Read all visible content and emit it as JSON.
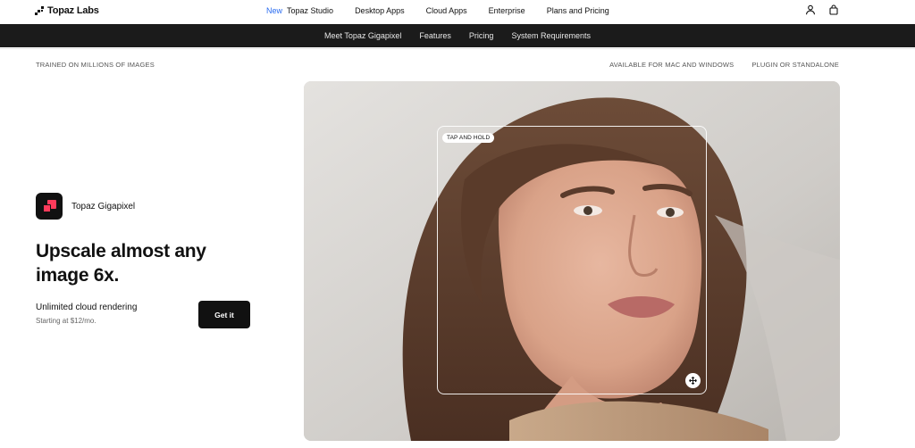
{
  "header": {
    "logo_text": "Topaz Labs",
    "nav": {
      "badge": "New",
      "items": [
        "Topaz Studio",
        "Desktop Apps",
        "Cloud Apps",
        "Enterprise",
        "Plans and Pricing"
      ]
    },
    "icons": [
      "user-icon",
      "cart-icon"
    ]
  },
  "subnav": {
    "items": [
      "Meet Topaz Gigapixel",
      "Features",
      "Pricing",
      "System Requirements"
    ]
  },
  "meta": {
    "left": "TRAINED ON MILLIONS OF IMAGES",
    "right": [
      "AVAILABLE FOR MAC AND WINDOWS",
      "PLUGIN OR STANDALONE"
    ]
  },
  "hero": {
    "product_name": "Topaz Gigapixel",
    "headline": "Upscale almost any image 6x.",
    "subtitle": "Unlimited cloud rendering",
    "price_note": "Starting at $12/mo.",
    "cta_label": "Get it",
    "compare_label": "TAP AND HOLD"
  },
  "colors": {
    "accent_new": "#2a6cf0",
    "subnav_bg": "#1b1b1b",
    "product_accent": "#ff3b5b"
  }
}
